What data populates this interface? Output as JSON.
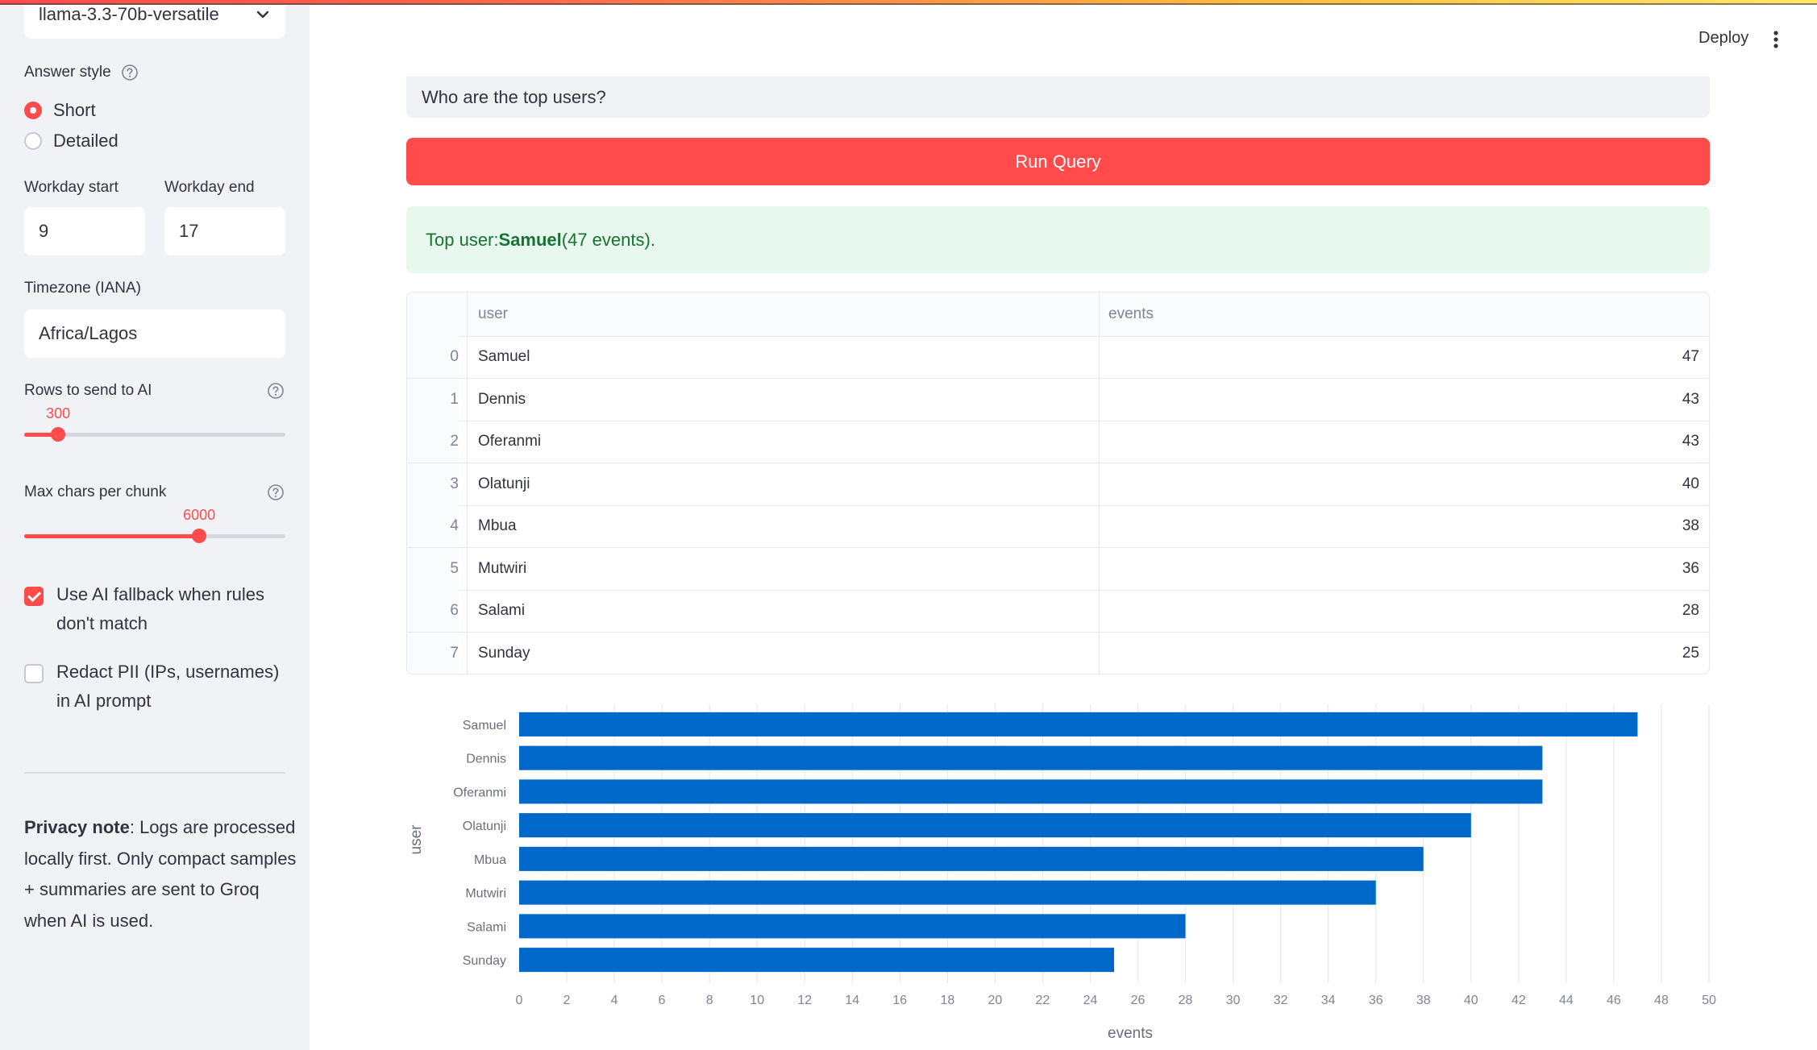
{
  "sidebar": {
    "model_select": {
      "value": "llama-3.3-70b-versatile"
    },
    "answer_style": {
      "label": "Answer style",
      "options": [
        "Short",
        "Detailed"
      ],
      "selected": "Short"
    },
    "workday_start": {
      "label": "Workday start",
      "value": "9"
    },
    "workday_end": {
      "label": "Workday end",
      "value": "17"
    },
    "timezone": {
      "label": "Timezone (IANA)",
      "value": "Africa/Lagos"
    },
    "rows_slider": {
      "label": "Rows to send to AI",
      "value": "300",
      "fraction": 0.13
    },
    "chars_slider": {
      "label": "Max chars per chunk",
      "value": "6000",
      "fraction": 0.67
    },
    "ai_fallback": {
      "label": "Use AI fallback when rules don't match",
      "checked": true
    },
    "redact_pii": {
      "label": "Redact PII (IPs, usernames) in AI prompt",
      "checked": false
    },
    "privacy_note": {
      "bold": "Privacy note",
      "text": ": Logs are processed locally first. Only compact samples + summaries are sent to Groq when AI is used."
    }
  },
  "header": {
    "deploy_label": "Deploy"
  },
  "main": {
    "question": "Who are the top users?",
    "run_button": "Run Query",
    "result": {
      "prefix": "Top user: ",
      "user": "Samuel",
      "suffix": " (47 events)."
    },
    "table": {
      "columns": [
        "user",
        "events"
      ],
      "rows": [
        {
          "index": "0",
          "user": "Samuel",
          "events": "47"
        },
        {
          "index": "1",
          "user": "Dennis",
          "events": "43"
        },
        {
          "index": "2",
          "user": "Oferanmi",
          "events": "43"
        },
        {
          "index": "3",
          "user": "Olatunji",
          "events": "40"
        },
        {
          "index": "4",
          "user": "Mbua",
          "events": "38"
        },
        {
          "index": "5",
          "user": "Mutwiri",
          "events": "36"
        },
        {
          "index": "6",
          "user": "Salami",
          "events": "28"
        },
        {
          "index": "7",
          "user": "Sunday",
          "events": "25"
        }
      ]
    }
  },
  "colors": {
    "accent": "#ff4b4b",
    "bar": "#0068c9",
    "success_bg": "#e8f8ee",
    "success_text": "#177233",
    "sidebar_bg": "#f0f2f6"
  },
  "chart_data": {
    "type": "bar",
    "orientation": "horizontal",
    "categories": [
      "Samuel",
      "Dennis",
      "Oferanmi",
      "Olatunji",
      "Mbua",
      "Mutwiri",
      "Salami",
      "Sunday"
    ],
    "values": [
      47,
      43,
      43,
      40,
      38,
      36,
      28,
      25
    ],
    "xlabel": "events",
    "ylabel": "user",
    "xlim": [
      0,
      50
    ],
    "xticks": [
      0,
      2,
      4,
      6,
      8,
      10,
      12,
      14,
      16,
      18,
      20,
      22,
      24,
      26,
      28,
      30,
      32,
      34,
      36,
      38,
      40,
      42,
      44,
      46,
      48,
      50
    ],
    "grid": "vertical"
  }
}
